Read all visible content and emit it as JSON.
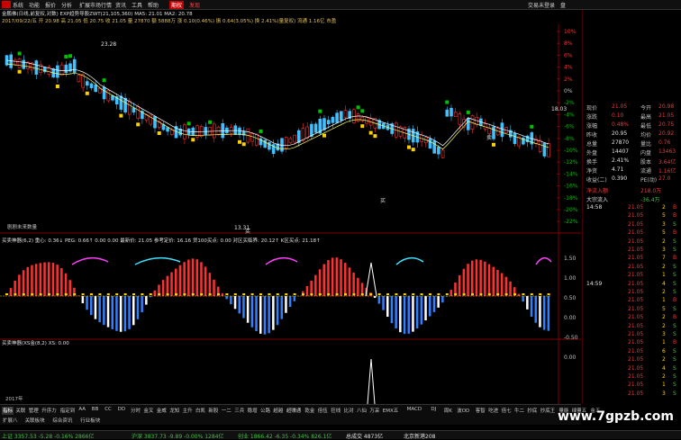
{
  "menu": {
    "items": [
      "系统",
      "功能",
      "报价",
      "分析",
      "扩展市场行情",
      "资讯",
      "工具",
      "帮助"
    ],
    "trading": "交易未登录",
    "k_button": "盘"
  },
  "chart": {
    "title_line": "金鹏佛(日线,前复权,对数) EXP趋势导股ZWT(21,105,360)  MA5: 21.01   MA2: 20.78",
    "info_line": "2017/09/22/五  开 20.98 高 21.05 低 20.75 收 21.05 量 27870 额 5888万 涨 0.10(0.46%) 振 0.64(3.05%) 换 2.41%(量复权) 流通 1.16亿 市盈",
    "price_marks": [
      "23.28",
      "18.03",
      "13.31"
    ],
    "pct_labels": [
      "10%",
      "8%",
      "6%",
      "4%",
      "2%",
      "0%",
      "-2%",
      "-4%",
      "-6%",
      "-8%",
      "-10%",
      "-12%",
      "-14%",
      "-16%",
      "-18%",
      "-20%",
      "-22%"
    ],
    "annotations": [
      "买",
      "卖",
      "买"
    ],
    "flag_text": "剧剧未来数量",
    "ind1_title": "买卖神器(6,2)  重心: 0.36↓         PEG: 0.66↑        0.00     0.00  最新价: 21.05  参考定价: 16.16  贷100买点: 0.00  对区买临界: 20.12↑  K区买点: 21.18↑",
    "ind1_labels": [
      "1.50",
      "1.00",
      "0.50",
      "0.00",
      "-0.50"
    ],
    "ind2_title": "买卖神器(XS金(8,2)  XS: 0.00",
    "ind2_labels": [
      "0.00"
    ],
    "ind2_date": "2017年"
  },
  "quote": {
    "rows": [
      {
        "l": "现价",
        "v": "21.05",
        "l2": "今开",
        "v2": "20.98"
      },
      {
        "l": "涨跌",
        "v": "0.10",
        "l2": "最高",
        "v2": "21.05"
      },
      {
        "l": "涨幅",
        "v": "0.48%",
        "l2": "最低",
        "v2": "20.75"
      },
      {
        "l": "昨收",
        "v": "20.95",
        "l2": "均价",
        "v2": "20.92"
      },
      {
        "l": "总量",
        "v": "27870",
        "l2": "量比",
        "v2": "0.76"
      },
      {
        "l": "外盘",
        "v": "14407",
        "l2": "内盘",
        "v2": "13463"
      },
      {
        "l": "换手",
        "v": "2.41%",
        "l2": "股本",
        "v2": "3.64亿"
      },
      {
        "l": "净资",
        "v": "4.71",
        "l2": "流通",
        "v2": "1.16亿"
      },
      {
        "l": "收益(二)",
        "v": "0.390",
        "l2": "PE(动)",
        "v2": "27.0"
      }
    ],
    "net_inflow_label": "净流入额",
    "net_inflow_value": "218.0万",
    "big_inflow_label": "大宗流入",
    "big_inflow_value": "-36.4万",
    "ticks": [
      {
        "t": "14:58",
        "p": "21.05",
        "v": "2",
        "d": "B"
      },
      {
        "t": "",
        "p": "21.05",
        "v": "5",
        "d": "B"
      },
      {
        "t": "",
        "p": "21.05",
        "v": "3",
        "d": "S"
      },
      {
        "t": "",
        "p": "21.05",
        "v": "5",
        "d": "B"
      },
      {
        "t": "",
        "p": "21.05",
        "v": "2",
        "d": "S"
      },
      {
        "t": "",
        "p": "21.05",
        "v": "3",
        "d": "S"
      },
      {
        "t": "",
        "p": "21.05",
        "v": "7",
        "d": "B"
      },
      {
        "t": "",
        "p": "21.05",
        "v": "2",
        "d": "S"
      },
      {
        "t": "",
        "p": "21.05",
        "v": "1",
        "d": "S"
      },
      {
        "t": "14:59",
        "p": "21.05",
        "v": "4",
        "d": "S"
      },
      {
        "t": "",
        "p": "21.05",
        "v": "2",
        "d": "S"
      },
      {
        "t": "",
        "p": "21.05",
        "v": "1",
        "d": "B"
      },
      {
        "t": "",
        "p": "21.05",
        "v": "5",
        "d": "S"
      },
      {
        "t": "",
        "p": "21.05",
        "v": "2",
        "d": "B"
      },
      {
        "t": "",
        "p": "21.05",
        "v": "2",
        "d": "S"
      },
      {
        "t": "",
        "p": "21.05",
        "v": "3",
        "d": "S"
      },
      {
        "t": "",
        "p": "21.05",
        "v": "1",
        "d": "B"
      },
      {
        "t": "",
        "p": "21.05",
        "v": "6",
        "d": "S"
      },
      {
        "t": "",
        "p": "21.05",
        "v": "2",
        "d": "S"
      },
      {
        "t": "",
        "p": "21.05",
        "v": "4",
        "d": "S"
      },
      {
        "t": "",
        "p": "21.05",
        "v": "2",
        "d": "S"
      },
      {
        "t": "",
        "p": "21.05",
        "v": "1",
        "d": "S"
      },
      {
        "t": "",
        "p": "21.05",
        "v": "3",
        "d": "S"
      }
    ]
  },
  "tabs": [
    "指标",
    "关联",
    "管理",
    "升序力",
    "指定到",
    "AA",
    "BB",
    "CC",
    "DD",
    "分时",
    "金叉",
    "金威",
    "龙知",
    "主升",
    "白凯",
    "新股",
    "一二",
    "三兵",
    "稳增",
    "公路",
    "超越",
    "超赚通",
    "乾金",
    "倍伍",
    "狂线",
    "比对",
    "八仙",
    "万采",
    "EMX五",
    "MACD",
    "DJ",
    "周K",
    "波OD",
    "客智",
    "吃进",
    "倍七",
    "牛二",
    "抄底",
    "抄底王",
    "量能",
    "绿量五",
    "金五"
  ],
  "tabs2": [
    "扩展八",
    "关联板块",
    "综合资讯",
    "行业板块"
  ],
  "status": [
    {
      "text": "上证 3357.53  -5.28  -0.16%  2866亿",
      "color": "#40c040"
    },
    {
      "text": "沪深 3837.73  -9.89  -0.00%  1284亿",
      "color": "#40c040"
    },
    {
      "text": "创业 1866.42  -6.35  -0.34%  826.1亿",
      "color": "#40c040"
    },
    {
      "text": "总成交 4873亿",
      "color": "#e0e0e0"
    },
    {
      "text": "北京新港208",
      "color": "#e0e0e0"
    }
  ],
  "watermark": "www.7gpzb.com",
  "colors": {
    "up": "#ff3030",
    "down": "#3080ff",
    "green": "#00c000",
    "yellow": "#ffd000",
    "magenta": "#ff40ff",
    "cyan": "#40e0ff",
    "white": "#ffffff"
  }
}
